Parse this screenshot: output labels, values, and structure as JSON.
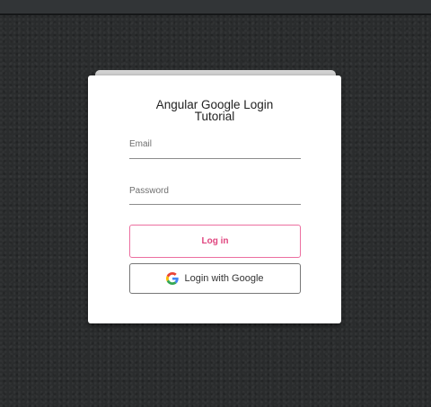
{
  "card": {
    "title_line1": "Angular Google Login",
    "title_line2": "Tutorial"
  },
  "form": {
    "email_label": "Email",
    "password_label": "Password",
    "login_label": "Log in",
    "google_label": "Login with Google"
  },
  "icons": {
    "google": "google-g-icon"
  },
  "colors": {
    "background": "#2a2c2d",
    "card": "#ffffff",
    "login_accent": "#e0457f",
    "google_border": "#777777"
  }
}
